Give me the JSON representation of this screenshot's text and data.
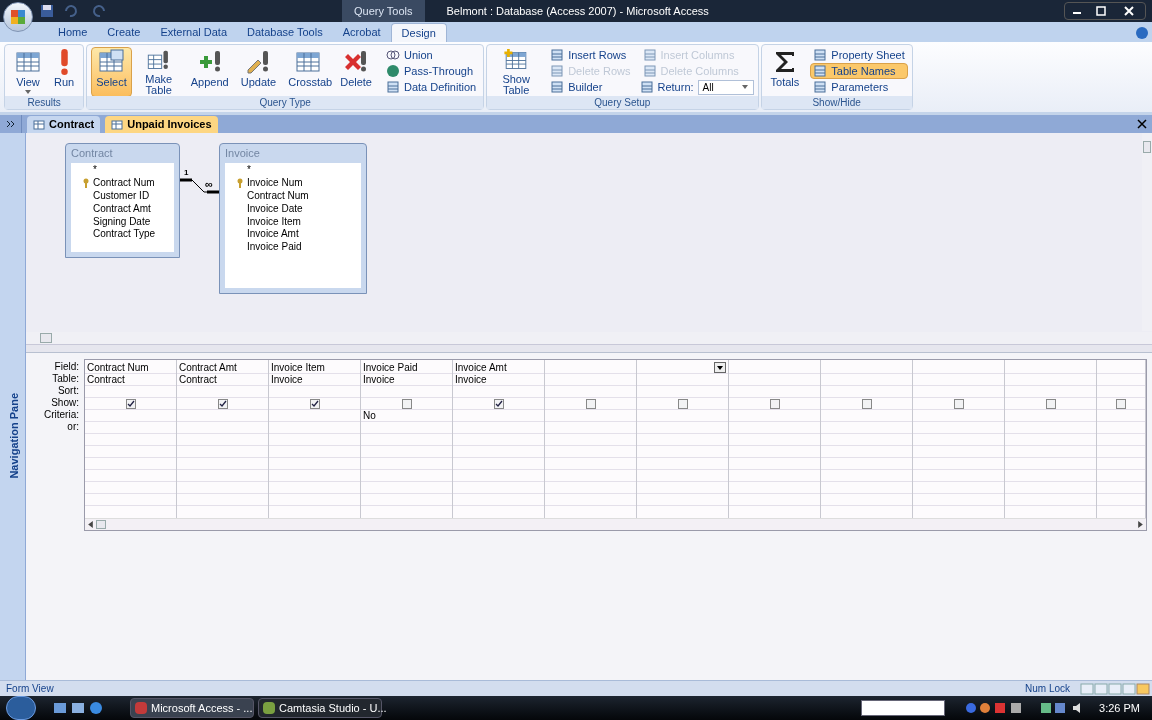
{
  "title_bar": {
    "context_label": "Query Tools",
    "title": "Belmont : Database (Access 2007) - Microsoft Access"
  },
  "ribbon_tabs": [
    {
      "label": "Home",
      "selected": false
    },
    {
      "label": "Create",
      "selected": false
    },
    {
      "label": "External Data",
      "selected": false
    },
    {
      "label": "Database Tools",
      "selected": false
    },
    {
      "label": "Acrobat",
      "selected": false
    },
    {
      "label": "Design",
      "selected": true
    }
  ],
  "ribbon_groups": [
    {
      "label": "Results",
      "large": [
        {
          "label": "View",
          "selected": false,
          "dropdown": true
        },
        {
          "label": "Run",
          "selected": false,
          "dropdown": false
        }
      ]
    },
    {
      "label": "Query Type",
      "large": [
        {
          "label": "Select",
          "selected": true,
          "dropdown": false
        },
        {
          "label": "Make Table",
          "selected": false,
          "dropdown": false
        },
        {
          "label": "Append",
          "selected": false,
          "dropdown": false
        },
        {
          "label": "Update",
          "selected": false,
          "dropdown": false
        },
        {
          "label": "Crosstab",
          "selected": false,
          "dropdown": false
        },
        {
          "label": "Delete",
          "selected": false,
          "dropdown": false
        }
      ],
      "small_columns": [
        [
          {
            "kind": "button",
            "label": "Union",
            "disabled": false,
            "selected": false
          },
          {
            "kind": "button",
            "label": "Pass-Through",
            "disabled": false,
            "selected": false
          },
          {
            "kind": "button",
            "label": "Data Definition",
            "disabled": false,
            "selected": false
          }
        ]
      ]
    },
    {
      "label": "Query Setup",
      "large": [
        {
          "label": "Show Table",
          "selected": false,
          "dropdown": false
        }
      ],
      "small_columns": [
        [
          {
            "kind": "button",
            "label": "Insert Rows",
            "disabled": false,
            "selected": false
          },
          {
            "kind": "button",
            "label": "Delete Rows",
            "disabled": true,
            "selected": false
          },
          {
            "kind": "button",
            "label": "Builder",
            "disabled": false,
            "selected": false
          }
        ],
        [
          {
            "kind": "button",
            "label": "Insert Columns",
            "disabled": true,
            "selected": false
          },
          {
            "kind": "button",
            "label": "Delete Columns",
            "disabled": true,
            "selected": false
          },
          {
            "kind": "dropdown",
            "label": "Return:",
            "value": "All"
          }
        ]
      ]
    },
    {
      "label": "Show/Hide",
      "large": [
        {
          "label": "Totals",
          "selected": false,
          "dropdown": false
        }
      ],
      "small_columns": [
        [
          {
            "kind": "button",
            "label": "Property Sheet",
            "disabled": false,
            "selected": false
          },
          {
            "kind": "button",
            "label": "Table Names",
            "disabled": false,
            "selected": true
          },
          {
            "kind": "button",
            "label": "Parameters",
            "disabled": false,
            "selected": false
          }
        ]
      ]
    }
  ],
  "doc_tabs": [
    {
      "label": "Contract",
      "selected": false
    },
    {
      "label": "Unpaid Invoices",
      "selected": true
    }
  ],
  "navigation_pane": {
    "label": "Navigation Pane"
  },
  "tables": [
    {
      "title": "Contract",
      "fields": [
        {
          "name": "*",
          "key": false
        },
        {
          "name": "Contract Num",
          "key": true
        },
        {
          "name": "Customer ID",
          "key": false
        },
        {
          "name": "Contract Amt",
          "key": false
        },
        {
          "name": "Signing Date",
          "key": false
        },
        {
          "name": "Contract Type",
          "key": false
        }
      ]
    },
    {
      "title": "Invoice",
      "fields": [
        {
          "name": "*",
          "key": false
        },
        {
          "name": "Invoice Num",
          "key": true
        },
        {
          "name": "Contract Num",
          "key": false
        },
        {
          "name": "Invoice Date",
          "key": false
        },
        {
          "name": "Invoice Item",
          "key": false
        },
        {
          "name": "Invoice Amt",
          "key": false
        },
        {
          "name": "Invoice Paid",
          "key": false
        }
      ]
    }
  ],
  "relationship": {
    "one_label": "1",
    "many_label": "∞"
  },
  "grid": {
    "row_labels": [
      "Field:",
      "Table:",
      "Sort:",
      "Show:",
      "Criteria:",
      "or:"
    ],
    "columns": [
      {
        "field": "Contract Num",
        "table": "Contract",
        "show": true,
        "focused": false
      },
      {
        "field": "Contract Amt",
        "table": "Contract",
        "show": true,
        "focused": false
      },
      {
        "field": "Invoice Item",
        "table": "Invoice",
        "show": true,
        "focused": false
      },
      {
        "field": "Invoice Paid",
        "table": "Invoice",
        "show": false,
        "criteria": "No",
        "focused": false
      },
      {
        "field": "Invoice Amt",
        "table": "Invoice",
        "show": true,
        "focused": false
      },
      {
        "show": false,
        "focused": false
      },
      {
        "show": false,
        "focused": true
      },
      {
        "show": false,
        "focused": false
      },
      {
        "show": false,
        "focused": false
      },
      {
        "show": false,
        "focused": false
      },
      {
        "show": false,
        "focused": false
      },
      {
        "show": false,
        "focused": false
      }
    ]
  },
  "status_bar": {
    "left": "Form View",
    "right": "Num Lock"
  },
  "taskbar": {
    "tasks": [
      {
        "label": "Microsoft Access - ...",
        "selected": true
      },
      {
        "label": "Camtasia Studio - U...",
        "selected": false
      }
    ],
    "clock": "3:26 PM"
  }
}
